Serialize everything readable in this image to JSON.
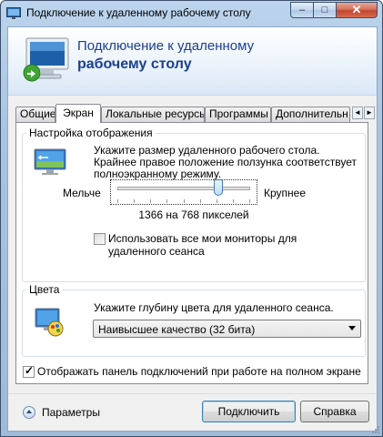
{
  "window": {
    "title": "Подключение к удаленному рабочему столу",
    "minimize_glyph": "–",
    "maximize_glyph": "□",
    "close_glyph": "✕"
  },
  "banner": {
    "line1": "Подключение к удаленному",
    "line2": "рабочему столу",
    "icon": "remote-desktop-icon"
  },
  "tabs": {
    "items": [
      "Общие",
      "Экран",
      "Локальные ресурсы",
      "Программы",
      "Дополнительн"
    ],
    "active_index": 1,
    "scroll_left": "◄",
    "scroll_right": "►"
  },
  "display": {
    "group_label": "Настройка отображения",
    "description": "Укажите размер удаленного рабочего стола. Крайнее правое положение ползунка соответствует полноэкранному режиму.",
    "less_label": "Мельче",
    "more_label": "Крупнее",
    "slider_fraction": 0.76,
    "resolution_text": "1366 на 768 пикселей",
    "all_monitors_label": "Использовать все мои мониторы для удаленного сеанса",
    "all_monitors_checked": false
  },
  "colors": {
    "group_label": "Цвета",
    "description": "Укажите глубину цвета для удаленного сеанса.",
    "selected_depth": "Наивысшее качество (32 бита)"
  },
  "connection_bar": {
    "label": "Отображать панель подключений при работе на полном экране",
    "checked": true,
    "check_glyph": "✓"
  },
  "footer": {
    "options_label": "Параметры",
    "connect_label": "Подключить",
    "help_label": "Справка"
  },
  "theme": {
    "banner_text_color": "#1b3f8f",
    "titlebar_color": "#a9c4e2",
    "close_button_color": "#c34530",
    "focus_border_color": "#3c7fb1"
  }
}
